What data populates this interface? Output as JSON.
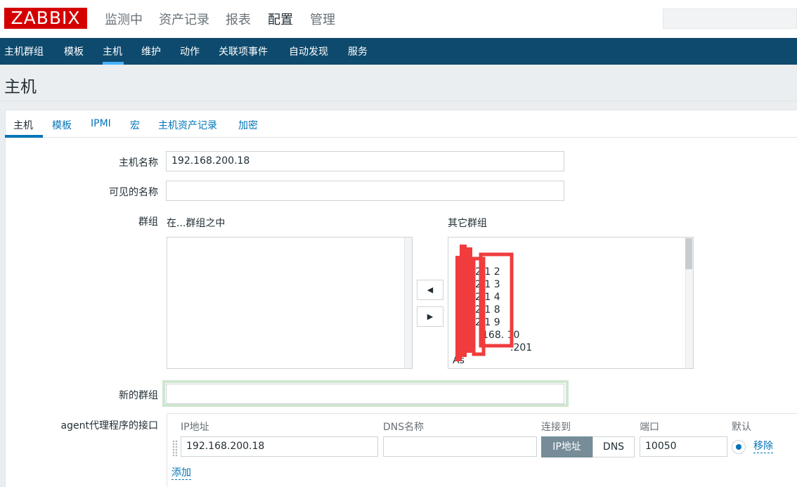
{
  "header": {
    "logo_text": "ZABBIX",
    "main_menu": [
      "监测中",
      "资产记录",
      "报表",
      "配置",
      "管理"
    ],
    "active_menu": "配置",
    "search_value": ""
  },
  "subnav": {
    "items": [
      "主机群组",
      "模板",
      "主机",
      "维护",
      "动作",
      "关联项事件",
      "自动发现",
      "服务"
    ],
    "active": "主机"
  },
  "page": {
    "title": "主机"
  },
  "tabs": {
    "items": [
      "主机",
      "模板",
      "IPMI",
      "宏",
      "主机资产记录",
      "加密"
    ],
    "active": "主机"
  },
  "form": {
    "host_name_label": "主机名称",
    "host_name_value": "192.168.200.18",
    "visible_name_label": "可见的名称",
    "visible_name_value": "",
    "groups_label": "群组",
    "in_groups_header": "在...群组之中",
    "other_groups_header": "其它群组",
    "in_groups_items": [],
    "other_groups_items": [
      "2.1 2",
      "2.1 3",
      "2.1 4",
      "2.1 8",
      "2.1 9",
      "168. 10",
      ".201",
      "As"
    ],
    "arrow_left": "◀",
    "arrow_right": "▶",
    "new_group_label": "新的群组",
    "new_group_value": "",
    "agent_label": "agent代理程序的接口"
  },
  "interface": {
    "headers": {
      "ip": "IP地址",
      "dns": "DNS名称",
      "connect": "连接到",
      "port": "端口",
      "default": "默认"
    },
    "ip_value": "192.168.200.18",
    "dns_value": "",
    "connect_options": [
      "IP地址",
      "DNS"
    ],
    "connect_selected": "IP地址",
    "port_value": "10050",
    "default_selected": true,
    "remove_label": "移除",
    "add_label": "添加"
  },
  "colors": {
    "brand_red": "#d40000",
    "nav_blue": "#0e4a6d",
    "link_blue": "#0275b8",
    "redaction_red": "#f03c3c"
  }
}
